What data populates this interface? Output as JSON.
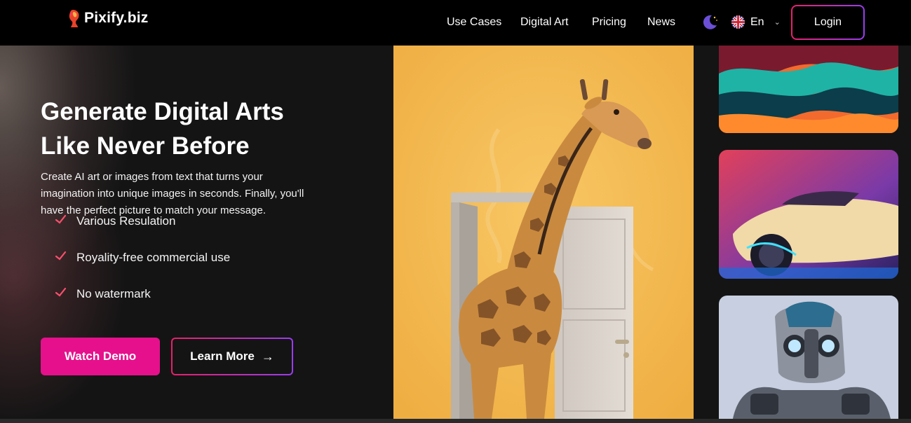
{
  "brand": {
    "name": "Pixify.biz"
  },
  "nav": {
    "links": [
      "Use Cases",
      "Digital Art",
      "Pricing",
      "News"
    ],
    "language": "En",
    "login_label": "Login"
  },
  "hero": {
    "headline_line1": "Generate Digital Arts",
    "headline_line2": "Like Never Before",
    "description": "Create AI art or images from text that turns your imagination into unique images in seconds. Finally, you'll have the perfect picture to match your message.",
    "features": [
      "Various Resulation",
      "Royality-free commercial use",
      "No watermark"
    ],
    "watch_demo_label": "Watch Demo",
    "learn_more_label": "Learn More"
  },
  "colors": {
    "accent_pink": "#e6108c",
    "gradient_start": "#e8206a",
    "gradient_end": "#9b3cf0",
    "hero_image_bg": "#f2b64c"
  },
  "icons": [
    "pixify-logo-icon",
    "moon-icon",
    "uk-flag-icon",
    "chevron-down-icon",
    "check-icon",
    "arrow-right-icon"
  ]
}
